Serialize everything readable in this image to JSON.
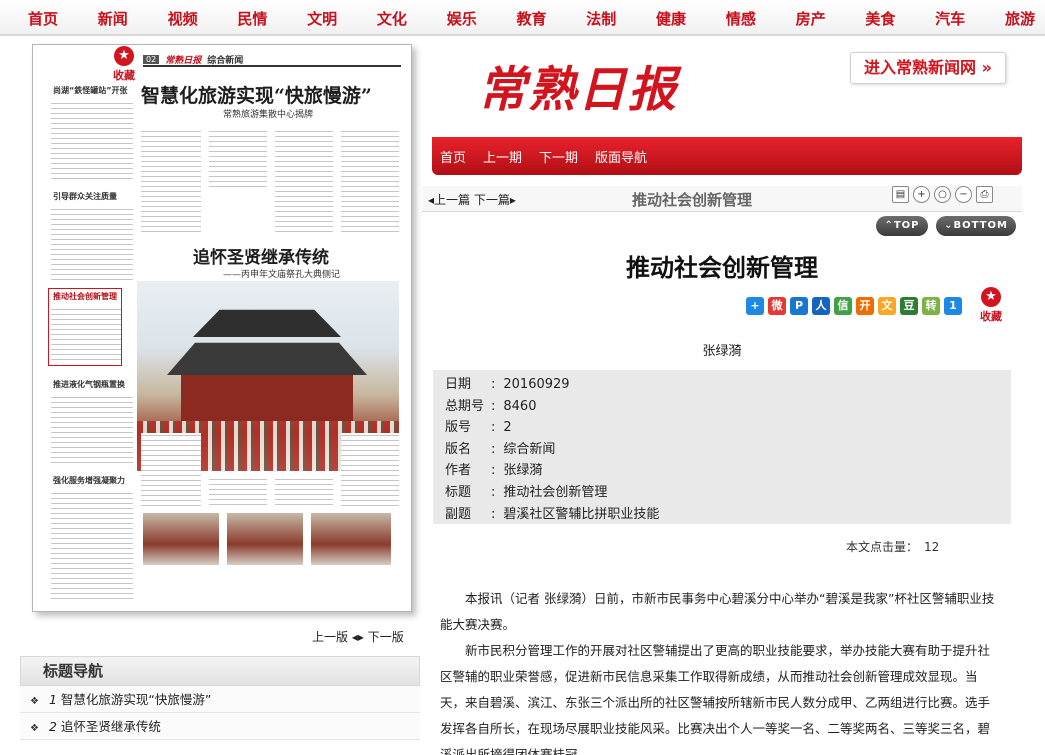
{
  "topnav": [
    "首页",
    "新闻",
    "视频",
    "民情",
    "文明",
    "文化",
    "娱乐",
    "教育",
    "法制",
    "健康",
    "情感",
    "房产",
    "美食",
    "汽车",
    "旅游"
  ],
  "paper": {
    "fav_label": "收藏",
    "mast_no": "02",
    "mast_logo": "常熟日报",
    "mast_section": "综合新闻",
    "headline": "智慧化旅游实现“快旅慢游”",
    "subheadline": "常熟旅游集散中心揭牌",
    "side_1": "尚湖“鉄怪罐站”开张",
    "side_2": "引导群众关注质量",
    "side_3": "推动社会创新管理",
    "side_4": "推进液化气钢瓶置换",
    "side_5": "强化服务增强凝聚力",
    "headline2": "追怀圣贤继承传统",
    "subheadline2": "——丙申年文庙祭孔大典侧记"
  },
  "masthead": {
    "logo": "常熟日报",
    "enter_button": "进入常熟新闻网 »"
  },
  "redbar": [
    "首页",
    "上一期",
    "下一期",
    "版面导航"
  ],
  "article_header": {
    "prev_next": "上一篇  下一篇",
    "title": "推动社会创新管理"
  },
  "pills": {
    "top": "TOP",
    "bottom": "BOTTOM"
  },
  "article": {
    "title": "推动社会创新管理",
    "author": "张绿漪",
    "fav_label": "收藏",
    "meta": [
      {
        "k": "日期",
        "v": "20160929"
      },
      {
        "k": "总期号",
        "v": "8460"
      },
      {
        "k": "版号",
        "v": "2"
      },
      {
        "k": "版名",
        "v": "综合新闻"
      },
      {
        "k": "作者",
        "v": "张绿漪"
      },
      {
        "k": "标题",
        "v": "推动社会创新管理"
      },
      {
        "k": "副题",
        "v": "碧溪社区警辅比拼职业技能"
      }
    ],
    "hits_label": "本文点击量：",
    "hits_value": "12",
    "paragraphs": [
      "本报讯（记者 张绿漪）日前，市新市民事务中心碧溪分中心举办“碧溪是我家”杯社区警辅职业技能大赛决赛。",
      "新市民积分管理工作的开展对社区警辅提出了更高的职业技能要求，举办技能大赛有助于提升社区警辅的职业荣誉感，促进新市民信息采集工作取得新成绩，从而推动社会创新管理成效显现。当天，来自碧溪、滨江、东张三个派出所的社区警辅按所辖新市民人数分成甲、乙两组进行比赛。选手发挥各自所长，在现场尽展职业技能风采。比赛决出个人一等奖一名、二等奖两名、三等奖三名，碧溪派出所摘得团体赛桂冠。"
    ]
  },
  "share_icons": [
    "plus-icon",
    "weibo-icon",
    "qzone-icon",
    "renren-icon",
    "wechat-icon",
    "kaixin-icon",
    "star-icon",
    "douban-icon",
    "sina-icon",
    "one-icon"
  ],
  "share_colors": [
    "#1e88e5",
    "#e53935",
    "#1976d2",
    "#1565c0",
    "#43a047",
    "#ef6c00",
    "#f9a825",
    "#2e7d32",
    "#7cb342",
    "#1e88e5"
  ],
  "share_glyphs": [
    "+",
    "微",
    "P",
    "人",
    "信",
    "开",
    "文",
    "豆",
    "转",
    "1"
  ],
  "page_nav": {
    "prev": "上一版",
    "next": "下一版"
  },
  "title_nav": {
    "heading": "标题导航",
    "items": [
      {
        "num": "1",
        "label": "智慧化旅游实现“快旅慢游”"
      },
      {
        "num": "2",
        "label": "追怀圣贤继承传统"
      }
    ]
  }
}
